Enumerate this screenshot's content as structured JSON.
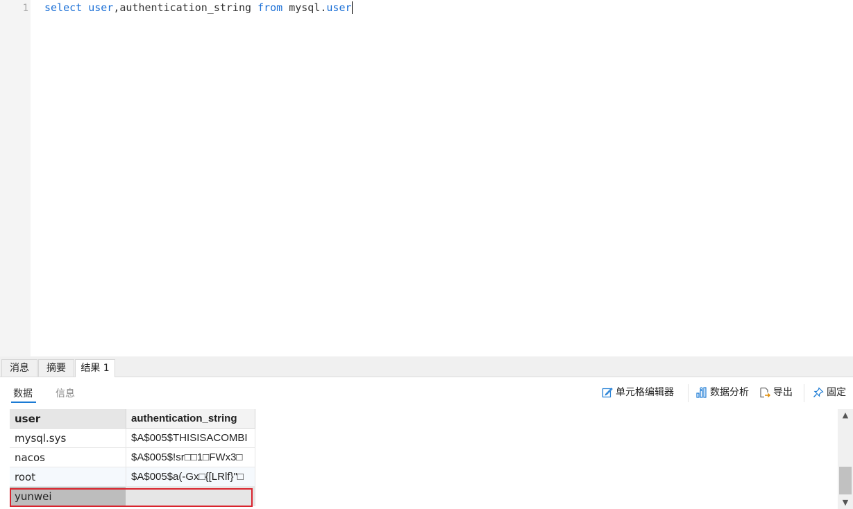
{
  "editor": {
    "line_number": "1",
    "query": {
      "kw_select": "select",
      "col_user": "user",
      "comma": ",",
      "col_auth": "authentication_string",
      "kw_from": "from",
      "table_db": "mysql",
      "dot": ".",
      "table_name": "user"
    }
  },
  "tabs": [
    {
      "label": "消息"
    },
    {
      "label": "摘要"
    },
    {
      "label": "结果 1",
      "active": true
    }
  ],
  "subtabs": [
    {
      "label": "数据",
      "active": true
    },
    {
      "label": "信息",
      "active": false
    }
  ],
  "toolbar": {
    "cell_editor": "单元格编辑器",
    "data_analysis": "数据分析",
    "export": "导出",
    "pin": "固定"
  },
  "grid": {
    "columns": [
      "user",
      "authentication_string"
    ],
    "rows": [
      [
        "mysql.sys",
        "$A$005$THISISACOMBI"
      ],
      [
        "nacos",
        "$A$005$!sr□□1□FWx3□"
      ],
      [
        "root",
        "$A$005$a(-Gx□{[LRlf}\"□"
      ],
      [
        "yunwei",
        ""
      ]
    ],
    "selected_row_index": 3
  },
  "colors": {
    "keyword": "#1a6fd6",
    "accent": "#1a7ad4",
    "selection_outline": "#d9232d"
  }
}
